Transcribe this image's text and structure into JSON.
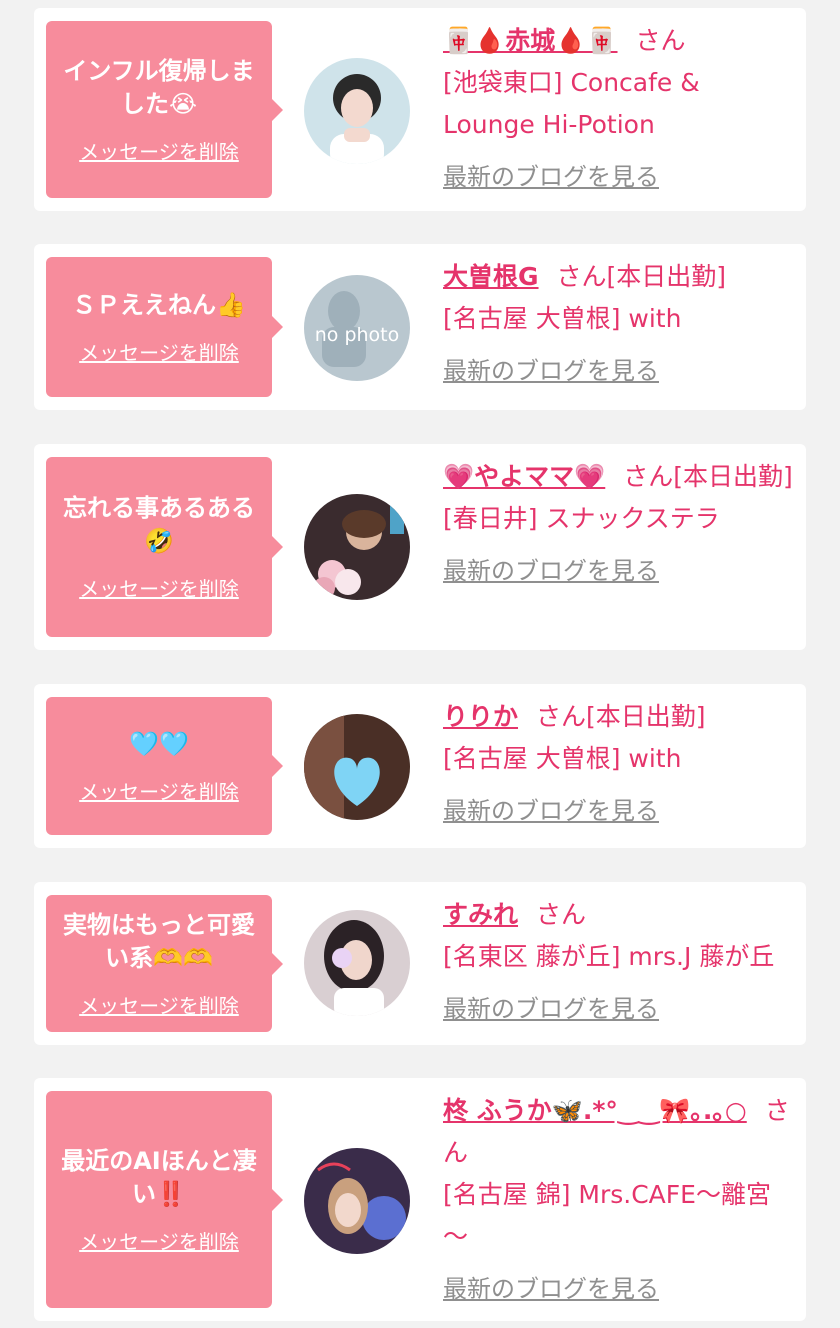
{
  "delete_label": "メッセージを削除",
  "blog_label": "最新のブログを見る",
  "san_label": "さん",
  "colors": {
    "bubble": "#f78c9c",
    "accent": "#e5346b",
    "link_gray": "#8f8f8f",
    "background": "#f2f2f2"
  },
  "items": [
    {
      "message": "インフル復帰しました😭",
      "name": "🀄🩸赤城🩸🀄",
      "status": "",
      "shop": "[池袋東口] Concafe & Lounge Hi-Potion"
    },
    {
      "message": "ＳＰええねん👍",
      "name": "大曽根G",
      "status": "[本日出勤]",
      "shop": "[名古屋 大曽根] with",
      "avatar_text": "no photo"
    },
    {
      "message": "忘れる事あるある🤣",
      "name": "💗やよママ💗",
      "status": "[本日出勤]",
      "shop": "[春日井] スナックステラ"
    },
    {
      "message": "🩵🩵",
      "name": "りりか",
      "status": "[本日出勤]",
      "shop": "[名古屋 大曽根] with"
    },
    {
      "message": "実物はもっと可愛い系🫶🫶",
      "name": "すみれ",
      "status": "",
      "shop": "[名東区 藤が丘] mrs.J 藤が丘"
    },
    {
      "message": "最近のAIほんと凄い‼️",
      "name": "柊 ふうか🦋.*°‿‿🎀｡.｡○",
      "status": "",
      "shop": "[名古屋 錦] Mrs.CAFE～離宮～"
    }
  ]
}
